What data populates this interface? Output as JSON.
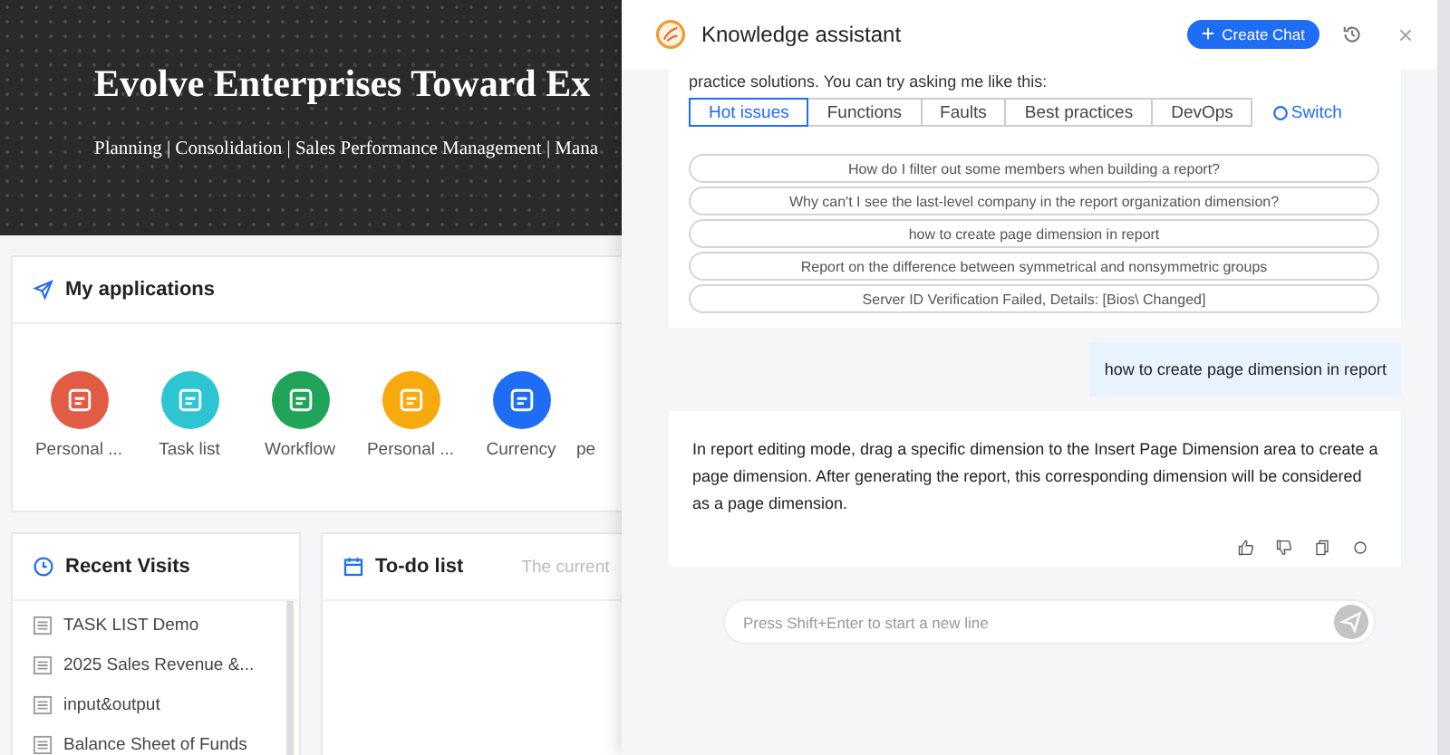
{
  "banner": {
    "title": "Evolve Enterprises Toward Ex",
    "subtitle": "Planning | Consolidation | Sales Performance Management | Mana"
  },
  "applications": {
    "title": "My applications",
    "items": [
      {
        "label": "Personal ...",
        "color": "#e25c45"
      },
      {
        "label": "Task list",
        "color": "#2ec5d3"
      },
      {
        "label": "Workflow",
        "color": "#22a35a"
      },
      {
        "label": "Personal ...",
        "color": "#f8a90d"
      },
      {
        "label": "Currency",
        "color": "#1f6cf5"
      },
      {
        "label": "pe"
      }
    ]
  },
  "recent_visits": {
    "title": "Recent Visits",
    "items": [
      "TASK LIST Demo",
      "2025 Sales Revenue &...",
      "input&output",
      "Balance Sheet of Funds"
    ]
  },
  "todo": {
    "title": "To-do list",
    "hint": "The current"
  },
  "assistant": {
    "title": "Knowledge assistant",
    "create_button": "Create Chat",
    "intro": "practice solutions. You can try asking me like this:",
    "tabs": [
      {
        "label": "Hot issues",
        "selected": true
      },
      {
        "label": "Functions",
        "selected": false
      },
      {
        "label": "Faults",
        "selected": false
      },
      {
        "label": "Best practices",
        "selected": false
      },
      {
        "label": "DevOps",
        "selected": false
      }
    ],
    "switch": "Switch",
    "questions": [
      "How do I filter out some members when building a report?",
      "Why can't I see the last-level company in the report organization dimension?",
      "how to create page dimension in report",
      "Report on the difference between symmetrical and nonsymmetric groups",
      "Server ID Verification Failed, Details: [Bios\\ Changed]"
    ],
    "user_message": "how to create page dimension in report",
    "answer": "In report editing mode, drag a specific dimension to the Insert Page Dimension area to create a page dimension. After generating the report, this corresponding dimension will be considered as a page dimension.",
    "input": {
      "placeholder": "Press Shift+Enter to start a new line"
    }
  }
}
